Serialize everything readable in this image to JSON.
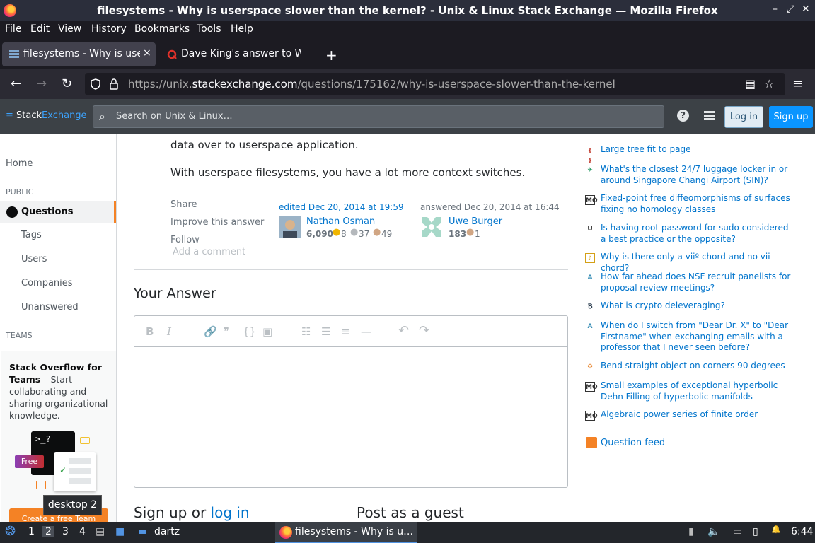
{
  "window": {
    "title": "filesystems - Why is userspace slower than the kernel? - Unix & Linux Stack Exchange — Mozilla Firefox",
    "min": "–",
    "max": "⤢",
    "close": "✕"
  },
  "menubar": [
    "File",
    "Edit",
    "View",
    "History",
    "Bookmarks",
    "Tools",
    "Help"
  ],
  "tabs": [
    {
      "label": "filesystems - Why is user",
      "close": "×"
    },
    {
      "label": "Dave King's answer to W",
      "close": "×"
    }
  ],
  "newtab": "+",
  "urlbar": {
    "url_pre": "https://unix.",
    "url_host": "stackexchange.com",
    "url_post": "/questions/175162/why-is-userspace-slower-than-the-kernel"
  },
  "se": {
    "logo_a": "Stack",
    "logo_b": "Exchange",
    "search_placeholder": "Search on Unix & Linux…",
    "help": "?",
    "login": "Log in",
    "signup": "Sign up"
  },
  "leftnav": {
    "home": "Home",
    "public": "PUBLIC",
    "questions": "Questions",
    "tags": "Tags",
    "users": "Users",
    "companies": "Companies",
    "unanswered": "Unanswered",
    "teams": "TEAMS",
    "teams_title": "Stack Overflow for Teams",
    "teams_desc": " – Start collaborating and sharing organizational knowledge.",
    "free_badge": "Free",
    "create_team": "Create a free Team",
    "terminal_prompt": ">_?"
  },
  "tooltip": "desktop 2",
  "answer": {
    "para1": "data over to userspace application.",
    "para2": "With userspace filesystems, you have a lot more context switches.",
    "share": "Share",
    "improve": "Improve this answer",
    "follow": "Follow",
    "edited": "edited Dec 20, 2014 at 19:59",
    "editor_name": "Nathan Osman",
    "editor_rep": "6,090",
    "editor_gold": "8",
    "editor_silver": "37",
    "editor_bronze": "49",
    "answered": "answered Dec 20, 2014 at 16:44",
    "author_name": "Uwe Burger",
    "author_rep": "183",
    "author_bronze": "1",
    "add_comment": "Add a comment"
  },
  "your_answer": {
    "heading": "Your Answer",
    "signup_pre": "Sign up or ",
    "signup_link": "log in",
    "guest": "Post as a guest"
  },
  "editor_toolbar": {
    "bold": "B",
    "italic": "I",
    "link": "🔗",
    "quote": "❞",
    "code": "{}",
    "image": "▣",
    "olist": "☷",
    "ulist": "☰",
    "heading": "≡",
    "rule": "—",
    "undo": "↶",
    "redo": "↷"
  },
  "hot_questions": [
    {
      "icon": "{ }",
      "icon_color": "#c0392b",
      "title": "Large tree fit to page"
    },
    {
      "icon": "✈",
      "icon_color": "#2e9c6a",
      "title": "What's the closest 24/7 luggage locker in or around Singapore Changi Airport (SIN)?"
    },
    {
      "icon": "MO",
      "icon_color": "#333333",
      "title": "Fixed-point free diffeomorphisms of surfaces fixing no homology classes"
    },
    {
      "icon": "U",
      "icon_color": "#222222",
      "title": "Is having root password for sudo considered a best practice or the opposite?"
    },
    {
      "icon": "♪",
      "icon_color": "#d4a017",
      "title": "Why is there only a viiº chord and no vii chord?"
    },
    {
      "icon": "A",
      "icon_color": "#3a8fb7",
      "title": "How far ahead does NSF recruit panelists for proposal review meetings?"
    },
    {
      "icon": "₿",
      "icon_color": "#2c3e50",
      "title": "What is crypto deleveraging?"
    },
    {
      "icon": "A",
      "icon_color": "#3a8fb7",
      "title": "When do I switch from \"Dear Dr. X\" to \"Dear Firstname\" when exchanging emails with a professor that I never seen before?"
    },
    {
      "icon": "⚙",
      "icon_color": "#e67e22",
      "title": "Bend straight object on corners 90 degrees"
    },
    {
      "icon": "MO",
      "icon_color": "#333333",
      "title": "Small examples of exceptional hyperbolic Dehn Filling of hyperbolic manifolds"
    },
    {
      "icon": "MO",
      "icon_color": "#333333",
      "title": "Algebraic power series of finite order"
    }
  ],
  "question_feed": "Question feed",
  "taskbar": {
    "ws1": "1",
    "ws2": "2",
    "ws3": "3",
    "ws4": "4",
    "folder": "dartz",
    "active_window": "filesystems - Why is u…",
    "clock": "6:44"
  },
  "colors": {
    "accent_orange": "#f48225",
    "link_blue": "#0074cc",
    "se_bar": "#3c4146"
  }
}
